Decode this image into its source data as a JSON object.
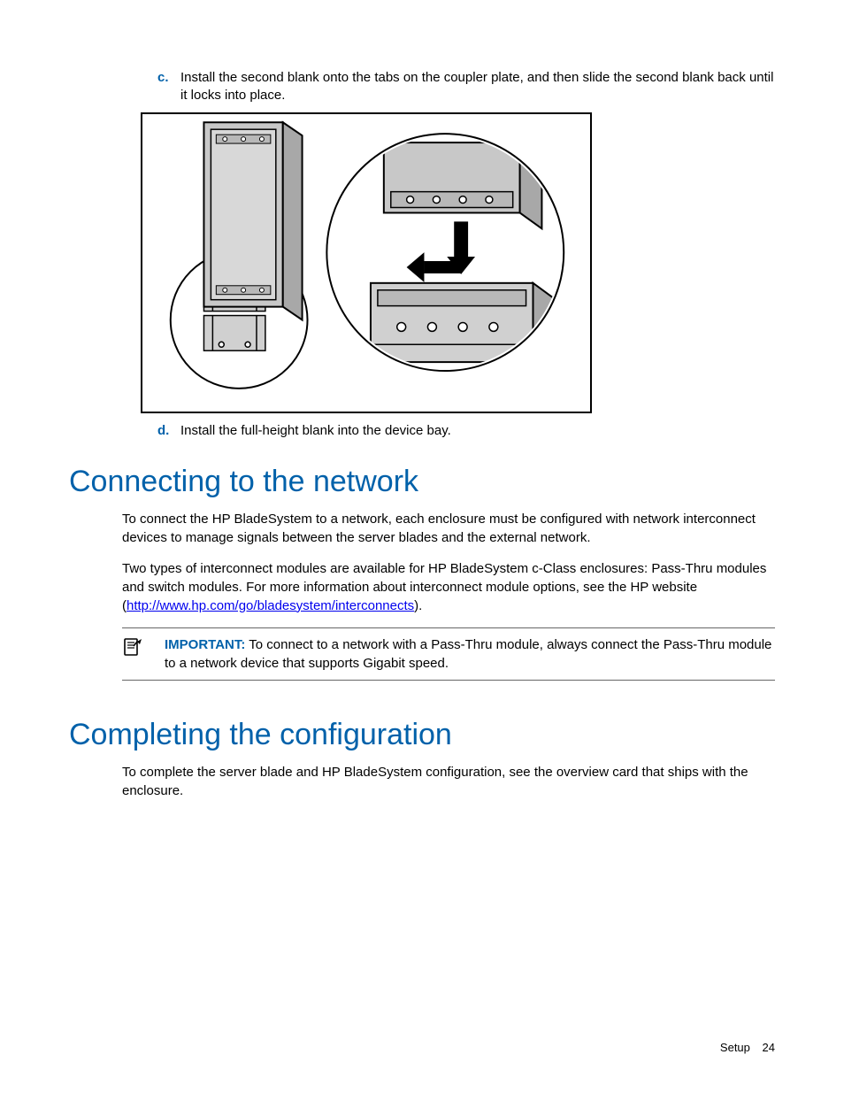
{
  "steps": {
    "c": {
      "marker": "c.",
      "text": "Install the second blank onto the tabs on the coupler plate, and then slide the second blank back until it locks into place."
    },
    "d": {
      "marker": "d.",
      "text": "Install the full-height blank into the device bay."
    }
  },
  "section1": {
    "heading": "Connecting to the network",
    "para1": "To connect the HP BladeSystem to a network, each enclosure must be configured with network interconnect devices to manage signals between the server blades and the external network.",
    "para2_pre": "Two types of interconnect modules are available for HP BladeSystem c-Class enclosures: Pass-Thru modules and switch modules. For more information about interconnect module options, see the HP website (",
    "para2_link": "http://www.hp.com/go/bladesystem/interconnects",
    "para2_post": ").",
    "important_label": "IMPORTANT:",
    "important_text": "  To connect to a network with a Pass-Thru module, always connect the Pass-Thru module to a network device that supports Gigabit speed."
  },
  "section2": {
    "heading": "Completing the configuration",
    "para": "To complete the server blade and HP BladeSystem configuration, see the overview card that ships with the enclosure."
  },
  "footer": {
    "section": "Setup",
    "page": "24"
  }
}
